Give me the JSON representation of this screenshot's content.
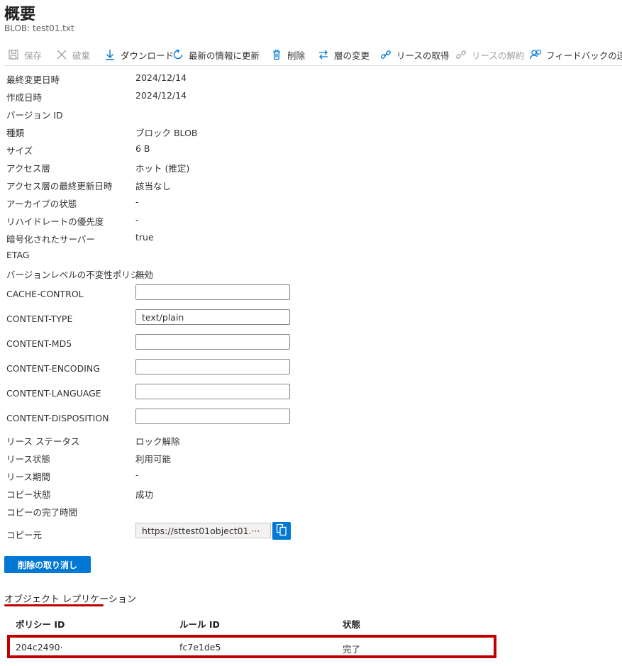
{
  "header": {
    "title": "概要",
    "subtitle": "BLOB: test01.txt"
  },
  "toolbar": {
    "save": "保存",
    "discard": "破棄",
    "download": "ダウンロード",
    "refresh": "最新の情報に更新",
    "delete": "削除",
    "change_tier": "層の変更",
    "acquire_lease": "リースの取得",
    "break_lease": "リースの解約",
    "feedback": "フィードバックの送信"
  },
  "properties": [
    {
      "label": "最終変更日時",
      "value": "2024/12/14"
    },
    {
      "label": "作成日時",
      "value": "2024/12/14"
    },
    {
      "label": "バージョン ID",
      "value": ""
    },
    {
      "label": "種類",
      "value": "ブロック BLOB"
    },
    {
      "label": "サイズ",
      "value": "6 B"
    },
    {
      "label": "アクセス層",
      "value": "ホット (推定)"
    },
    {
      "label": "アクセス層の最終更新日時",
      "value": "該当なし"
    },
    {
      "label": "アーカイブの状態",
      "value": "-"
    },
    {
      "label": "リハイドレートの優先度",
      "value": "-"
    },
    {
      "label": "暗号化されたサーバー",
      "value": "true"
    },
    {
      "label": "ETAG",
      "value": ""
    },
    {
      "label": "バージョンレベルの不変性ポリシー",
      "value": "無効"
    }
  ],
  "editable": [
    {
      "label": "CACHE-CONTROL",
      "value": ""
    },
    {
      "label": "CONTENT-TYPE",
      "value": "text/plain"
    },
    {
      "label": "CONTENT-MD5",
      "value": ""
    },
    {
      "label": "CONTENT-ENCODING",
      "value": ""
    },
    {
      "label": "CONTENT-LANGUAGE",
      "value": ""
    },
    {
      "label": "CONTENT-DISPOSITION",
      "value": ""
    }
  ],
  "lease": [
    {
      "label": "リース ステータス",
      "value": "ロック解除"
    },
    {
      "label": "リース状態",
      "value": "利用可能"
    },
    {
      "label": "リース期間",
      "value": "-"
    },
    {
      "label": "コピー状態",
      "value": "成功"
    },
    {
      "label": "コピーの完了時間",
      "value": ""
    }
  ],
  "copy_source": {
    "label": "コピー元",
    "value": "https://sttest01object01.···"
  },
  "undelete_button": "削除の取り消し",
  "replication": {
    "title": "オブジェクト レプリケーション",
    "columns": [
      "ポリシー ID",
      "ルール ID",
      "状態"
    ],
    "rows": [
      [
        "204c2490·",
        "fc7e1de5",
        "完了"
      ]
    ]
  },
  "colors": {
    "accent": "#0078d4",
    "highlight": "#c00000"
  }
}
